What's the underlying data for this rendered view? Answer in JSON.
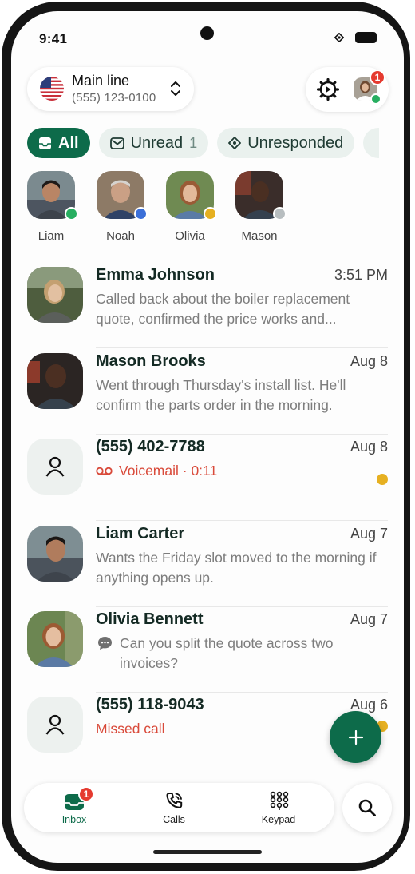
{
  "status_bar": {
    "time": "9:41"
  },
  "header": {
    "line_name": "Main line",
    "line_number": "(555) 123-0100",
    "notification_count": "1"
  },
  "filters": [
    {
      "label": "All",
      "count": ""
    },
    {
      "label": "Unread",
      "count": "1"
    },
    {
      "label": "Unresponded",
      "count": ""
    }
  ],
  "stories": [
    {
      "name": "Liam",
      "status_color": "#27ae60"
    },
    {
      "name": "Noah",
      "status_color": "#3b6fd8"
    },
    {
      "name": "Olivia",
      "status_color": "#e6b021"
    },
    {
      "name": "Mason",
      "status_color": "#b8bec0"
    }
  ],
  "conversations": [
    {
      "name": "Emma Johnson",
      "date": "3:51 PM",
      "preview": "Called back about the boiler replacement quote, confirmed the price works and..."
    },
    {
      "name": "Mason Brooks",
      "date": "Aug 8",
      "preview": "Went through Thursday's install list. He'll confirm the parts order in the morning."
    },
    {
      "name": "(555) 402-7788",
      "date": "Aug 8",
      "preview": "Voicemail · 0:11",
      "unread": true
    },
    {
      "name": "Liam Carter",
      "date": "Aug 7",
      "preview": "Wants the Friday slot moved to the morning if anything opens up."
    },
    {
      "name": "Olivia Bennett",
      "date": "Aug 7",
      "preview": "Can you split the quote across two invoices?"
    },
    {
      "name": "(555) 118-9043",
      "date": "Aug 6",
      "preview": "Missed call",
      "unread": true
    }
  ],
  "nav": {
    "inbox_label": "Inbox",
    "inbox_badge": "1",
    "calls_label": "Calls",
    "keypad_label": "Keypad"
  },
  "colors": {
    "brand": "#0d6b4a",
    "alert": "#e53a2f",
    "voicemail": "#d94a3a",
    "unread_dot": "#e6b021"
  }
}
